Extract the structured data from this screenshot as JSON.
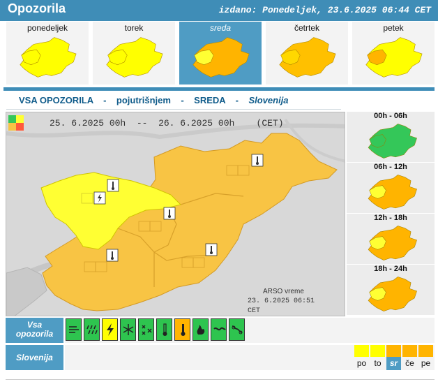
{
  "header": {
    "title": "Opozorila",
    "issued": "izdano: Ponedeljek, 23.6.2025 06:44 CET"
  },
  "days": [
    {
      "label": "ponedeljek",
      "active": false,
      "fill_main": "#ffff00",
      "fill_west": "#ffff00"
    },
    {
      "label": "torek",
      "active": false,
      "fill_main": "#ffff00",
      "fill_west": "#ffff00"
    },
    {
      "label": "sreda",
      "active": true,
      "fill_main": "#ffb400",
      "fill_west": "#ffff33"
    },
    {
      "label": "četrtek",
      "active": false,
      "fill_main": "#ffc000",
      "fill_west": "#ffd800"
    },
    {
      "label": "petek",
      "active": false,
      "fill_main": "#ffff00",
      "fill_west": "#ffb400"
    }
  ],
  "subtitle": {
    "part1": "VSA OPOZORILA",
    "dash": "-",
    "part2": "pojutrišnjem",
    "part3": "SREDA",
    "region": "Slovenija"
  },
  "map": {
    "date_from": "25. 6.2025",
    "time_from": "00h",
    "range_sep": "--",
    "date_to": "26. 6.2025",
    "time_to": "00h",
    "tz": "(CET)",
    "source_name": "ARSO vreme",
    "source_time": "23. 6.2025  06:51 CET",
    "colors": {
      "yellow": "#ffff33",
      "orange": "#f8c444",
      "green": "#34c759",
      "red": "#ff5a3c",
      "background": "#d8d8d8"
    }
  },
  "slots": [
    {
      "label": "00h - 06h",
      "fill_main": "#34c759",
      "fill_west": "#34c759"
    },
    {
      "label": "06h - 12h",
      "fill_main": "#ffb400",
      "fill_west": "#ffff33"
    },
    {
      "label": "12h - 18h",
      "fill_main": "#ffb400",
      "fill_west": "#ffff33"
    },
    {
      "label": "18h - 24h",
      "fill_main": "#ffb400",
      "fill_west": "#ffff33"
    }
  ],
  "bottom": {
    "all_label_line1": "Vsa",
    "all_label_line2": "opozorila",
    "region_label": "Slovenija",
    "types": [
      {
        "icon": "wind-icon",
        "color": "#2ec44f"
      },
      {
        "icon": "rain-icon",
        "color": "#2ec44f"
      },
      {
        "icon": "thunderstorm-icon",
        "color": "#ffff00"
      },
      {
        "icon": "snow-icon",
        "color": "#2ec44f"
      },
      {
        "icon": "ice-icon",
        "color": "#2ec44f"
      },
      {
        "icon": "low-temperature-icon",
        "color": "#2ec44f"
      },
      {
        "icon": "high-temperature-icon",
        "color": "#ffb400"
      },
      {
        "icon": "fire-risk-icon",
        "color": "#2ec44f"
      },
      {
        "icon": "fog-icon",
        "color": "#2ec44f"
      },
      {
        "icon": "coastal-icon",
        "color": "#2ec44f"
      }
    ],
    "week": [
      {
        "label": "po",
        "color": "#ffff00",
        "active": false
      },
      {
        "label": "to",
        "color": "#ffff00",
        "active": false
      },
      {
        "label": "sr",
        "color": "#ffb400",
        "active": true
      },
      {
        "label": "če",
        "color": "#ffb400",
        "active": false
      },
      {
        "label": "pe",
        "color": "#ffb400",
        "active": false
      }
    ]
  }
}
